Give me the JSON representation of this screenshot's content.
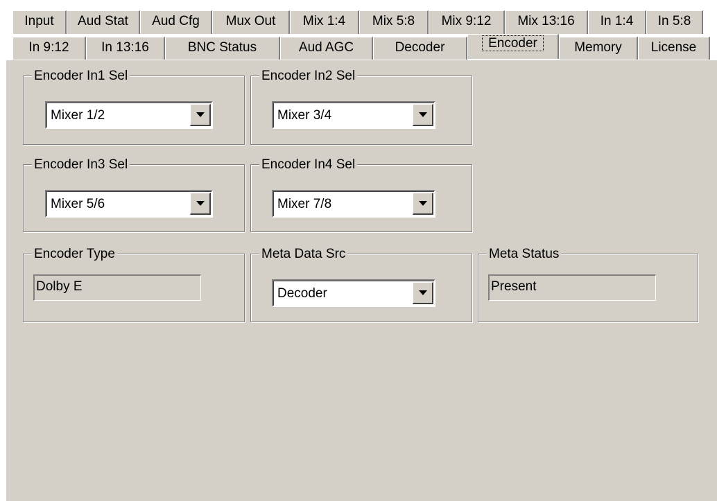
{
  "tabs": {
    "row1": [
      "Input",
      "Aud Stat",
      "Aud Cfg",
      "Mux Out",
      "Mix 1:4",
      "Mix 5:8",
      "Mix 9:12",
      "Mix 13:16",
      "In 1:4",
      "In 5:8"
    ],
    "row2": [
      "In 9:12",
      "In 13:16",
      "BNC Status",
      "Aud AGC",
      "Decoder",
      "Encoder",
      "Memory",
      "License"
    ],
    "selected": "Encoder"
  },
  "groups": {
    "in1": {
      "label": "Encoder In1 Sel",
      "value": "Mixer 1/2"
    },
    "in2": {
      "label": "Encoder In2 Sel",
      "value": "Mixer 3/4"
    },
    "in3": {
      "label": "Encoder In3 Sel",
      "value": "Mixer 5/6"
    },
    "in4": {
      "label": "Encoder In4 Sel",
      "value": "Mixer 7/8"
    },
    "encoder_type": {
      "label": "Encoder Type",
      "value": "Dolby E"
    },
    "meta_src": {
      "label": "Meta Data Src",
      "value": "Decoder"
    },
    "meta_status": {
      "label": "Meta Status",
      "value": "Present"
    }
  },
  "icons": {
    "dropdown_arrow": "triangle-down"
  },
  "colors": {
    "face": "#d4d0c8",
    "shadow": "#808080",
    "highlight": "#ffffff"
  }
}
